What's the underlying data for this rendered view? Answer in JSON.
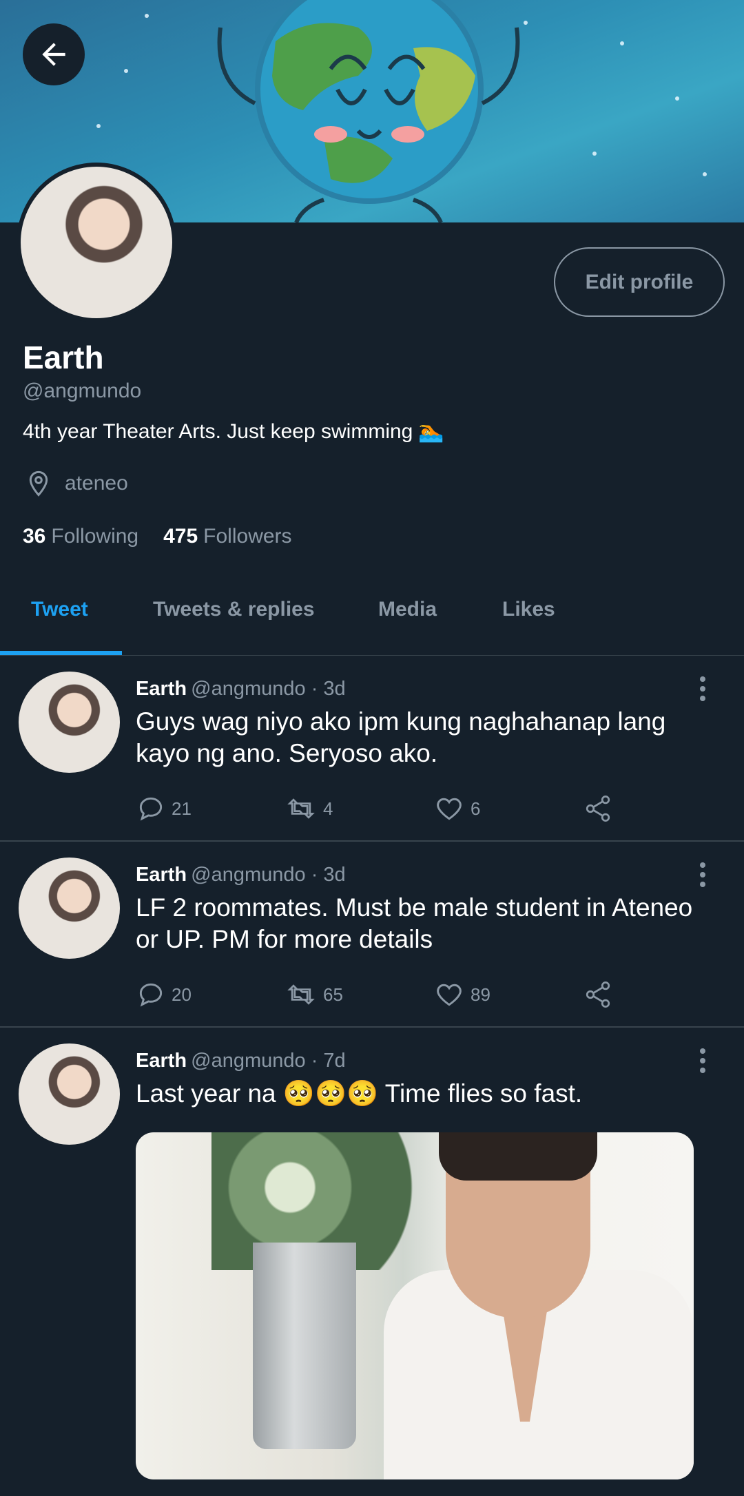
{
  "header": {
    "back_icon": "arrow-left-icon",
    "banner_image": "cartoon-earth-banner"
  },
  "profile": {
    "name": "Earth",
    "handle": "@angmundo",
    "bio": "4th year Theater Arts. Just keep swimming",
    "bio_emoji": "🏊",
    "location": "ateneo",
    "following_count": "36",
    "following_label": "Following",
    "followers_count": "475",
    "followers_label": "Followers",
    "edit_profile_label": "Edit profile"
  },
  "tabs": [
    {
      "label": "Tweet",
      "active": true
    },
    {
      "label": "Tweets & replies",
      "active": false
    },
    {
      "label": "Media",
      "active": false
    },
    {
      "label": "Likes",
      "active": false
    }
  ],
  "tweets": [
    {
      "author": "Earth",
      "handle_time": "@angmundo · 3d",
      "text": "Guys wag niyo ako ipm kung naghahanap lang kayo ng ano. Seryoso ako.",
      "replies": "21",
      "retweets": "4",
      "likes": "6"
    },
    {
      "author": "Earth",
      "handle_time": "@angmundo · 3d",
      "text": "LF 2 roommates. Must be male student in Ateneo or UP. PM for more details",
      "replies": "20",
      "retweets": "65",
      "likes": "89"
    },
    {
      "author": "Earth",
      "handle_time": "@angmundo · 7d",
      "text": "Last year na 🥺🥺🥺 Time flies so fast."
    }
  ],
  "colors": {
    "background": "#15202b",
    "accent": "#1da1f2",
    "secondary_text": "#8b98a5",
    "divider": "#38444d"
  }
}
